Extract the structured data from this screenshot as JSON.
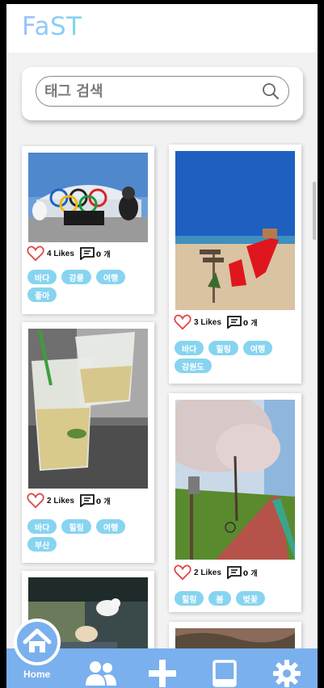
{
  "app": {
    "title": "FaST"
  },
  "search": {
    "placeholder": "태그 검색"
  },
  "posts": [
    {
      "likes_label": "4 Likes",
      "comments_label": "0 개",
      "tags": [
        "바다",
        "강릉",
        "여행",
        "좋아"
      ],
      "photo": "olympic-rings-plaza"
    },
    {
      "likes_label": "3 Likes",
      "comments_label": "0 개",
      "tags": [
        "바다",
        "힐링",
        "여행",
        "강원도"
      ],
      "photo": "beach-red-chair"
    },
    {
      "likes_label": "2 Likes",
      "comments_label": "0 개",
      "tags": [
        "바다",
        "힐링",
        "여행",
        "부산"
      ],
      "photo": "iced-drinks"
    },
    {
      "likes_label": "2 Likes",
      "comments_label": "0 개",
      "tags": [
        "힐링",
        "봄",
        "벚꽃"
      ],
      "photo": "cherry-blossom-path"
    },
    {
      "photo": "cafe-dog"
    },
    {
      "photo": "trees"
    }
  ],
  "nav": {
    "home_label": "Home",
    "items": [
      {
        "icon": "home-icon"
      },
      {
        "icon": "users-icon"
      },
      {
        "icon": "plus-icon"
      },
      {
        "icon": "tablet-icon"
      },
      {
        "icon": "gear-icon"
      }
    ]
  },
  "colors": {
    "accent": "#7ab0ee",
    "tag": "#87d4f0",
    "heart": "#e04848"
  }
}
